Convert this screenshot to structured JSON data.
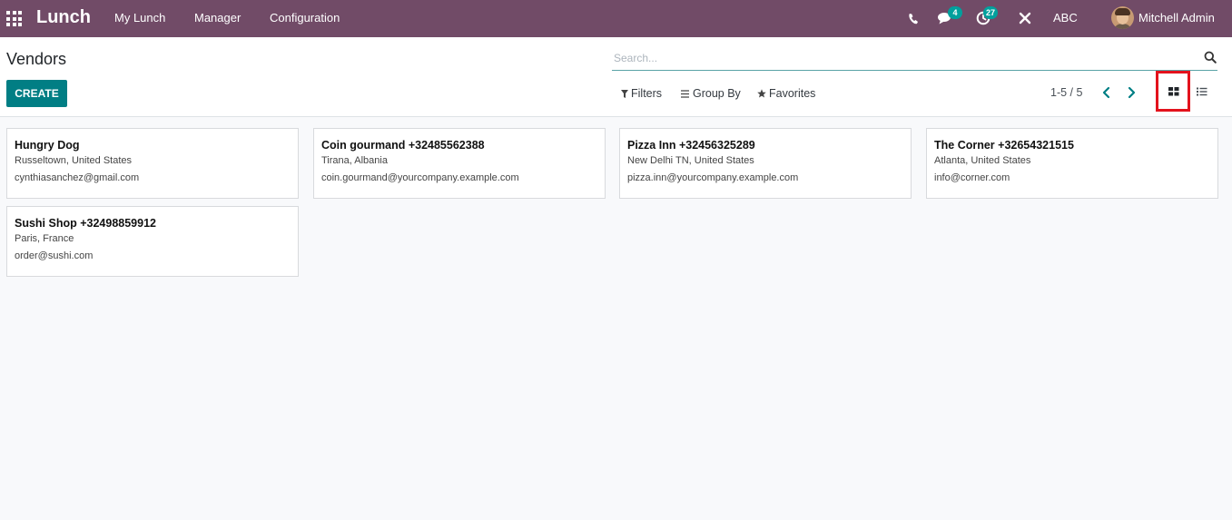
{
  "navbar": {
    "app_name": "Lunch",
    "menu": [
      "My Lunch",
      "Manager",
      "Configuration"
    ],
    "messages_count": "4",
    "activities_count": "27",
    "company": "ABC",
    "user_name": "Mitchell Admin",
    "background_color": "#714b67",
    "badge_color": "#00a09d"
  },
  "control_panel": {
    "title": "Vendors",
    "create_label": "CREATE",
    "search_placeholder": "Search...",
    "filters_label": "Filters",
    "group_by_label": "Group By",
    "favorites_label": "Favorites",
    "pager": "1-5 / 5",
    "active_view": "kanban",
    "accent_color": "#017e84",
    "highlight_color": "#e3121d"
  },
  "vendors": [
    {
      "name": "Hungry Dog",
      "location": "Russeltown, United States",
      "email": "cynthiasanchez@gmail.com"
    },
    {
      "name": "Coin gourmand +32485562388",
      "location": "Tirana, Albania",
      "email": "coin.gourmand@yourcompany.example.com"
    },
    {
      "name": "Pizza Inn +32456325289",
      "location": "New Delhi TN, United States",
      "email": "pizza.inn@yourcompany.example.com"
    },
    {
      "name": "The Corner +32654321515",
      "location": "Atlanta, United States",
      "email": "info@corner.com"
    },
    {
      "name": "Sushi Shop +32498859912",
      "location": "Paris, France",
      "email": "order@sushi.com"
    }
  ],
  "icons": [
    "apps-grid-icon",
    "phone-icon",
    "chat-icon",
    "clock-icon",
    "tools-icon",
    "search-icon",
    "filter-icon",
    "group-by-icon",
    "star-icon",
    "chevron-left-icon",
    "chevron-right-icon",
    "kanban-view-icon",
    "list-view-icon"
  ]
}
